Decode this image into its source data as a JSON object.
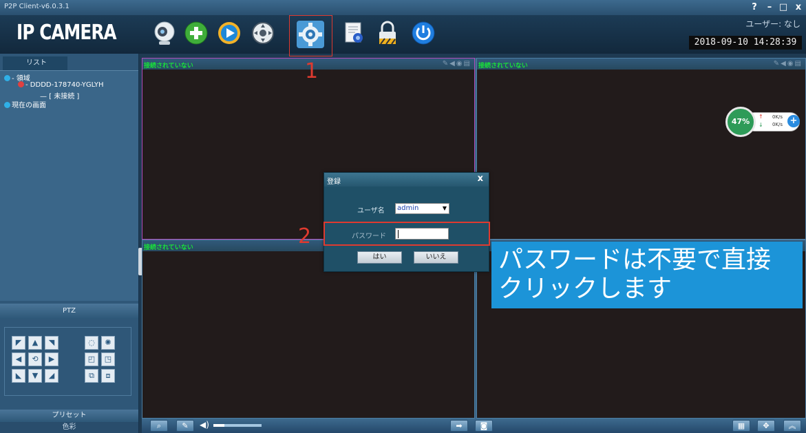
{
  "window": {
    "title": "P2P Client-v6.0.3.1",
    "help_label": "?",
    "minimize_label": "–",
    "maximize_label": "□",
    "close_label": "x"
  },
  "header": {
    "logo": "IP CAMERA",
    "toolbar_icons": [
      "camera-icon",
      "add-device-icon",
      "playback-icon",
      "ptz-control-icon",
      "settings-icon",
      "log-icon",
      "lock-icon",
      "power-icon"
    ],
    "user_label": "ユーザー: なし",
    "datetime": "2018-09-10 14:28:39"
  },
  "sidebar": {
    "tab_label": "リスト",
    "tree": {
      "root": "- 領域",
      "device": "- DDDD-178740-YGLYH",
      "status": "— [ 未接続 ]",
      "current": "現在の画面"
    },
    "ptz_label": "PTZ",
    "preset_label": "プリセット",
    "color_label": "色彩"
  },
  "video_panes": [
    {
      "label": "接続されていない"
    },
    {
      "label": "接続されていない"
    },
    {
      "label": "接続されていない"
    },
    {
      "label": ""
    }
  ],
  "speed_widget": {
    "percent": "47%",
    "upload": "0K/s",
    "download": "0K/s"
  },
  "login_dialog": {
    "title": "登録",
    "close_label": "x",
    "username_label": "ユーザ名",
    "username_value": "admin",
    "password_label": "パスワード",
    "password_value": "",
    "ok_label": "はい",
    "cancel_label": "いいえ"
  },
  "markers": {
    "step1": "1",
    "step2": "2"
  },
  "annotation": {
    "line1": "パスワードは不要で直接",
    "line2": "クリックします"
  },
  "colors": {
    "highlight": "#e03a2f",
    "annotation_bg": "#1c94d8",
    "pane_label": "#19e23a"
  }
}
